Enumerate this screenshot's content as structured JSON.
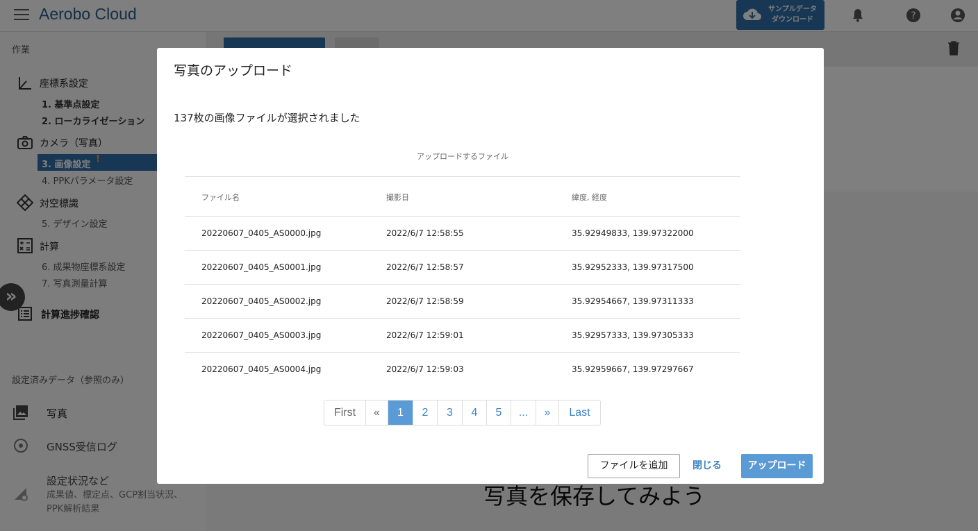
{
  "header": {
    "brand": "Aerobo Cloud",
    "sample_line1": "サンプルデータ",
    "sample_line2": "ダウンロード"
  },
  "sidebar": {
    "work_label": "作業",
    "coord_head": "座標系設定",
    "coord_items": [
      "1. 基準点設定",
      "2. ローカライゼーション"
    ],
    "camera_head": "カメラ（写真）",
    "camera_active": "3. 画像設定",
    "camera_active_warn": "!",
    "camera_item": "4. PPKパラメータ設定",
    "target_head": "対空標識",
    "target_item": "5. デザイン設定",
    "calc_head": "計算",
    "calc_items": [
      "6. 成果物座標系設定",
      "7. 写真測量計算"
    ],
    "progress_head": "計算進捗確認",
    "ref_label": "設定済みデータ（参照のみ）",
    "photos": "写真",
    "gnss": "GNSS受信ログ",
    "status": "設定状況など",
    "status_sub1": "成果値、標定点、GCP割当状況、",
    "status_sub2": "PPK解析結果",
    "collapse_glyph": "»"
  },
  "main": {
    "bg_text": "写真を保存してみよう"
  },
  "modal": {
    "title": "写真のアップロード",
    "info": "137枚の画像ファイルが選択されました",
    "caption": "アップロードするファイル",
    "columns": [
      "ファイル名",
      "撮影日",
      "緯度, 経度"
    ],
    "rows": [
      [
        "20220607_0405_AS0000.jpg",
        "2022/6/7 12:58:55",
        "35.92949833, 139.97322000"
      ],
      [
        "20220607_0405_AS0001.jpg",
        "2022/6/7 12:58:57",
        "35.92952333, 139.97317500"
      ],
      [
        "20220607_0405_AS0002.jpg",
        "2022/6/7 12:58:59",
        "35.92954667, 139.97311333"
      ],
      [
        "20220607_0405_AS0003.jpg",
        "2022/6/7 12:59:01",
        "35.92957333, 139.97305333"
      ],
      [
        "20220607_0405_AS0004.jpg",
        "2022/6/7 12:59:03",
        "35.92959667, 139.97297667"
      ]
    ],
    "pager": {
      "first": "First",
      "prev": "«",
      "pages": [
        "1",
        "2",
        "3",
        "4",
        "5"
      ],
      "current": "1",
      "ellipsis": "...",
      "next": "»",
      "last": "Last"
    },
    "add_file": "ファイルを追加",
    "close": "閉じる",
    "upload": "アップロード"
  },
  "colors": {
    "primary": "#2f6ea8",
    "accent_link": "#3b82c4",
    "button_light": "#5b9bd5",
    "warning": "#f5a623"
  }
}
